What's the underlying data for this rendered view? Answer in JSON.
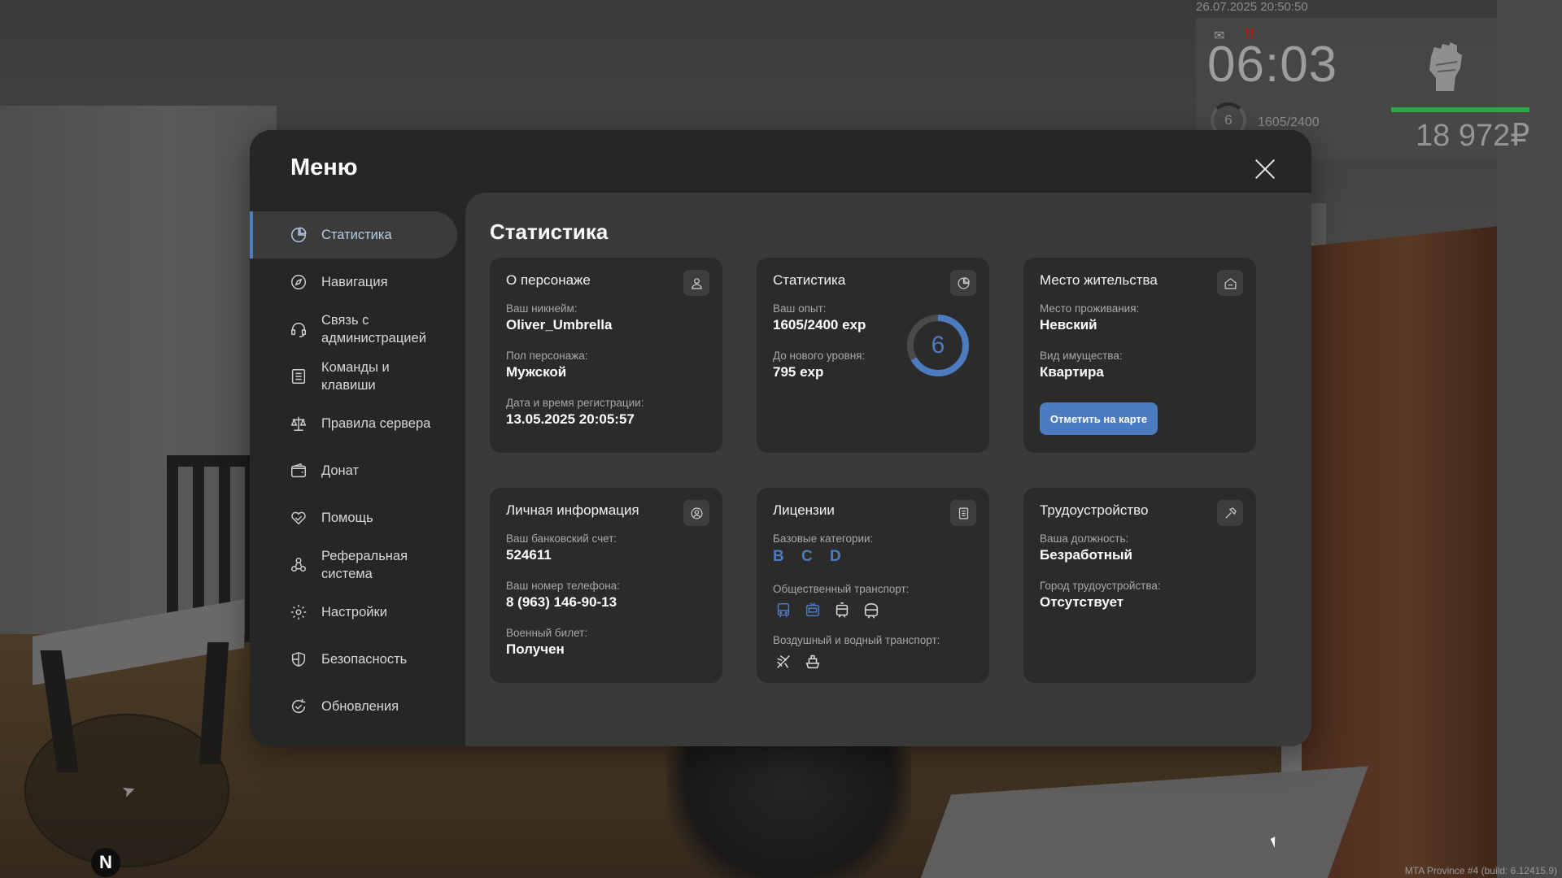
{
  "hud": {
    "datetime": "26.07.2025 20:50:50",
    "time": "06:03",
    "level": "6",
    "exp": "1605/2400",
    "money": "18 972₽",
    "alert": "!!",
    "health_fraction": 1.0
  },
  "minimap": {
    "north_label": "N"
  },
  "build_info": "MTA Province #4 (build: 6.12415.9)",
  "menu": {
    "title": "Меню",
    "sidebar": [
      {
        "label": "Статистика",
        "icon": "pie-chart-icon",
        "active": true
      },
      {
        "label": "Навигация",
        "icon": "compass-icon"
      },
      {
        "label": "Связь с администрацией",
        "icon": "headset-icon"
      },
      {
        "label": "Команды и клавиши",
        "icon": "list-icon"
      },
      {
        "label": "Правила сервера",
        "icon": "scales-icon"
      },
      {
        "label": "Донат",
        "icon": "wallet-icon"
      },
      {
        "label": "Помощь",
        "icon": "heart-handshake-icon"
      },
      {
        "label": "Реферальная система",
        "icon": "referral-icon"
      },
      {
        "label": "Настройки",
        "icon": "gear-icon"
      },
      {
        "label": "Безопасность",
        "icon": "shield-icon"
      },
      {
        "label": "Обновления",
        "icon": "refresh-check-icon"
      }
    ],
    "accent_color": "#4d7bbf"
  },
  "content": {
    "title": "Статистика",
    "character": {
      "title": "О персонаже",
      "nickname_label": "Ваш никнейм:",
      "nickname": "Oliver_Umbrella",
      "gender_label": "Пол персонажа:",
      "gender": "Мужской",
      "reg_label": "Дата и время регистрации:",
      "reg_date": "13.05.2025 20:05:57"
    },
    "stats": {
      "title": "Статистика",
      "exp_label": "Ваш опыт:",
      "exp": "1605/2400 exp",
      "next_label": "До нового уровня:",
      "next": "795 exp",
      "level": "6",
      "progress": 0.669
    },
    "residence": {
      "title": "Место жительства",
      "place_label": "Место проживания:",
      "place": "Невский",
      "type_label": "Вид имущества:",
      "type": "Квартира",
      "map_button": "Отметить на карте"
    },
    "personal": {
      "title": "Личная информация",
      "bank_label": "Ваш банковский счет:",
      "bank": "524611",
      "phone_label": "Ваш номер телефона:",
      "phone": "8 (963) 146-90-13",
      "military_label": "Военный билет:",
      "military": "Получен"
    },
    "licenses": {
      "title": "Лицензии",
      "base_label": "Базовые категории:",
      "base": "B C D",
      "public_label": "Общественный транспорт:",
      "public_icons": [
        "bus-icon",
        "trolleybus-icon",
        "tram-icon",
        "metro-icon"
      ],
      "air_label": "Воздушный и водный транспорт:",
      "air_icons": [
        "plane-icon",
        "ship-icon"
      ]
    },
    "job": {
      "title": "Трудоустройство",
      "position_label": "Ваша должность:",
      "position": "Безработный",
      "city_label": "Город трудоустройства:",
      "city": "Отсутствует"
    }
  }
}
